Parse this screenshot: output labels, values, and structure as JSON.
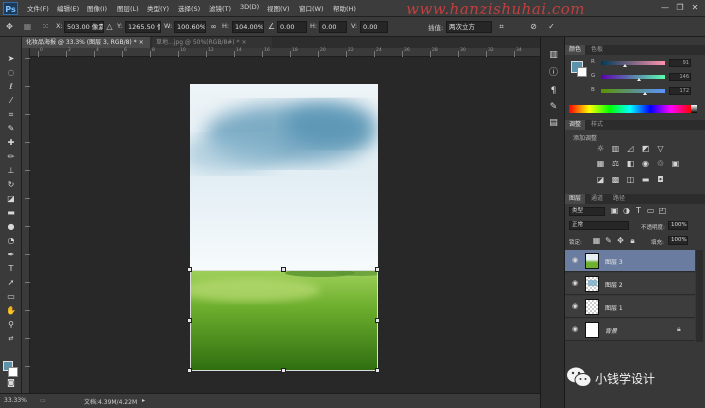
{
  "app": {
    "logo": "Ps"
  },
  "menu": [
    "文件(F)",
    "编辑(E)",
    "图像(I)",
    "图层(L)",
    "类型(Y)",
    "选择(S)",
    "滤镜(T)",
    "3D(D)",
    "视图(V)",
    "窗口(W)",
    "帮助(H)"
  ],
  "watermark_url": "www.hanzishuhai.com",
  "options": {
    "x_label": "X:",
    "x_value": "503.00 像素",
    "y_label": "Y:",
    "y_value": "1265.50 像",
    "w_label": "W:",
    "w_value": "100.60%",
    "h_label": "H:",
    "h_value": "104.00%",
    "angle_value": "0.00",
    "h_skew_label": "H:",
    "h_skew_value": "0.00",
    "v_skew_label": "V:",
    "v_skew_value": "0.00",
    "interp_label": "插值:",
    "interp_value": "两次立方"
  },
  "tabs": [
    {
      "label": "化妆品海报 @ 33.3% (图层 3, RGB/8) * ×"
    },
    {
      "label": "草地...jpg @ 50%(RGB/8#) * ×"
    }
  ],
  "ruler_labels": [
    "0",
    "2",
    "4",
    "6",
    "8",
    "10",
    "12",
    "14",
    "16",
    "18",
    "20",
    "22",
    "24",
    "26",
    "28",
    "30",
    "32",
    "34"
  ],
  "status": {
    "zoom": "33.33%",
    "doc": "文档:4.39M/4.22M"
  },
  "panels": {
    "color_tabs": [
      "颜色",
      "色板"
    ],
    "color_sliders": [
      {
        "label": "R",
        "value": "91",
        "fraction": 0.36
      },
      {
        "label": "G",
        "value": "146",
        "fraction": 0.57
      },
      {
        "label": "B",
        "value": "172",
        "fraction": 0.67
      }
    ],
    "adjust_tabs": [
      "调整",
      "样式"
    ],
    "adjust_title": "添加调整",
    "layers_tabs": [
      "图层",
      "通道",
      "路径"
    ],
    "kind_label": "类型",
    "blend_mode": "正常",
    "opacity_label": "不透明度:",
    "opacity_value": "100%",
    "lock_label": "锁定:",
    "fill_label": "填充:",
    "fill_value": "100%",
    "layers": [
      {
        "name": "图层 3",
        "selected": true
      },
      {
        "name": "图层 2",
        "selected": false
      },
      {
        "name": "图层 1",
        "selected": false
      },
      {
        "name": "背景",
        "selected": false
      }
    ]
  },
  "wechat_mark": "小钱学设计",
  "colors": {
    "foreground": "#5b93ad",
    "background": "#ffffff",
    "selection": "#6a7da0"
  }
}
